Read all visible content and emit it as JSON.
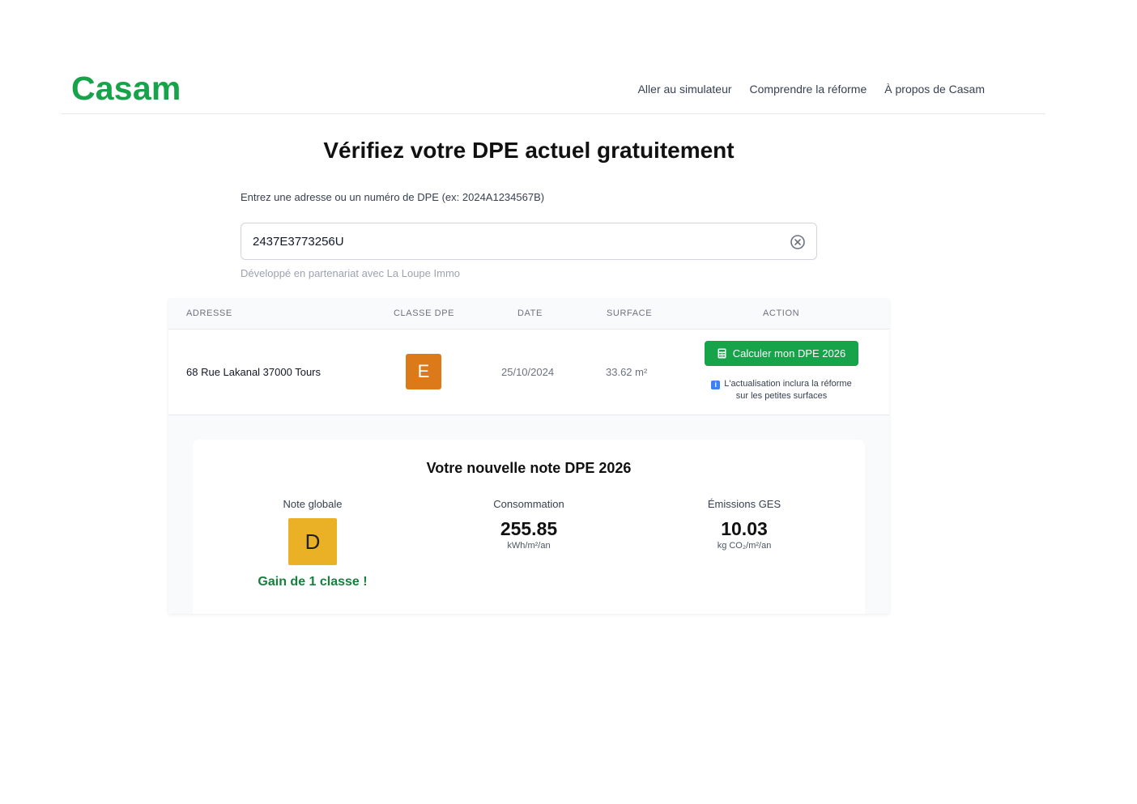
{
  "header": {
    "logo": "Casam",
    "nav": [
      "Aller au simulateur",
      "Comprendre la réforme",
      "À propos de Casam"
    ]
  },
  "page_title": "Vérifiez votre DPE actuel gratuitement",
  "search": {
    "label": "Entrez une adresse ou un numéro de DPE (ex: 2024A1234567B)",
    "value": "2437E3773256U",
    "partner_note": "Développé en partenariat avec La Loupe Immo"
  },
  "table": {
    "headers": [
      "ADRESSE",
      "CLASSE DPE",
      "DATE",
      "SURFACE",
      "ACTION"
    ],
    "row": {
      "address": "68 Rue Lakanal 37000 Tours",
      "classe": "E",
      "date": "25/10/2024",
      "surface": "33.62 m²",
      "action_label": "Calculer mon DPE 2026",
      "action_note": "L'actualisation inclura la réforme sur les petites surfaces"
    }
  },
  "result": {
    "title": "Votre nouvelle note DPE 2026",
    "note_label": "Note globale",
    "note": "D",
    "gain": "Gain de 1 classe !",
    "conso_label": "Consommation",
    "conso_value": "255.85",
    "conso_unit": "kWh/m²/an",
    "ges_label": "Émissions GES",
    "ges_value": "10.03",
    "ges_unit": "kg CO₂/m²/an"
  },
  "colors": {
    "brand": "#16a34a",
    "class_e": "#dc7a1a",
    "class_d": "#eab126"
  }
}
